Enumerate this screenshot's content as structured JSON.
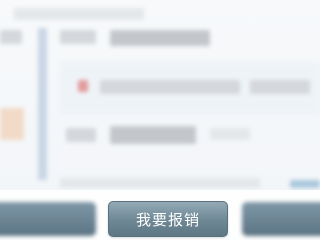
{
  "action_bar": {
    "primary_button_label": "我要报销"
  },
  "colors": {
    "button_top": "#93a9b6",
    "button_bottom": "#5e7886",
    "timeline_line": "#c9d6e6",
    "accent_red": "#e29a9a"
  }
}
